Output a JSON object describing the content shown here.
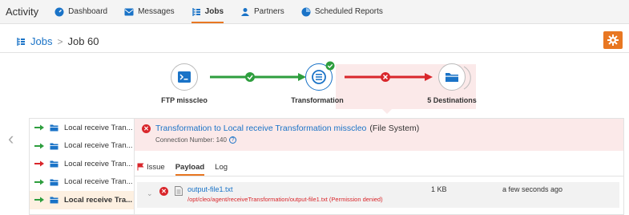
{
  "topnav": {
    "brand": "Activity",
    "items": [
      {
        "label": "Dashboard",
        "icon": "dashboard-icon",
        "active": false
      },
      {
        "label": "Messages",
        "icon": "messages-icon",
        "active": false
      },
      {
        "label": "Jobs",
        "icon": "jobs-icon",
        "active": true
      },
      {
        "label": "Partners",
        "icon": "partners-icon",
        "active": false
      },
      {
        "label": "Scheduled Reports",
        "icon": "scheduled-reports-icon",
        "active": false
      }
    ]
  },
  "breadcrumb": {
    "root": "Jobs",
    "separator": ">",
    "current": "Job 60"
  },
  "flow": {
    "nodes": [
      {
        "label": "FTP misscleo",
        "icon": "terminal-icon"
      },
      {
        "label": "Transformation",
        "icon": "transform-icon"
      },
      {
        "label": "5 Destinations",
        "icon": "folder-icon"
      }
    ],
    "links": [
      {
        "status": "success"
      },
      {
        "status": "error"
      }
    ]
  },
  "sidebar": {
    "items": [
      {
        "label": "Local receive Tran...",
        "status": "success",
        "selected": false
      },
      {
        "label": "Local receive Tran...",
        "status": "success",
        "selected": false
      },
      {
        "label": "Local receive Tran...",
        "status": "error",
        "selected": false
      },
      {
        "label": "Local receive Tran...",
        "status": "success",
        "selected": false
      },
      {
        "label": "Local receive Tra...",
        "status": "success",
        "selected": true
      }
    ]
  },
  "detail": {
    "title": "Transformation to Local receive Transformation misscleo",
    "system": "(File System)",
    "connection": "Connection Number: 140",
    "tabs": [
      "Issue",
      "Payload",
      "Log"
    ],
    "active_tab": "Payload",
    "file": {
      "name": "output-file1.txt",
      "path": "/opt/cleo/agent/receiveTransformation/output-file1.txt (Permission denied)",
      "size": "1 KB",
      "time": "a few seconds ago"
    }
  },
  "colors": {
    "accent": "#e87722",
    "link": "#1a73c7",
    "success": "#2e9e3e",
    "error": "#d9262b",
    "error_bg": "#fbe9e9"
  }
}
